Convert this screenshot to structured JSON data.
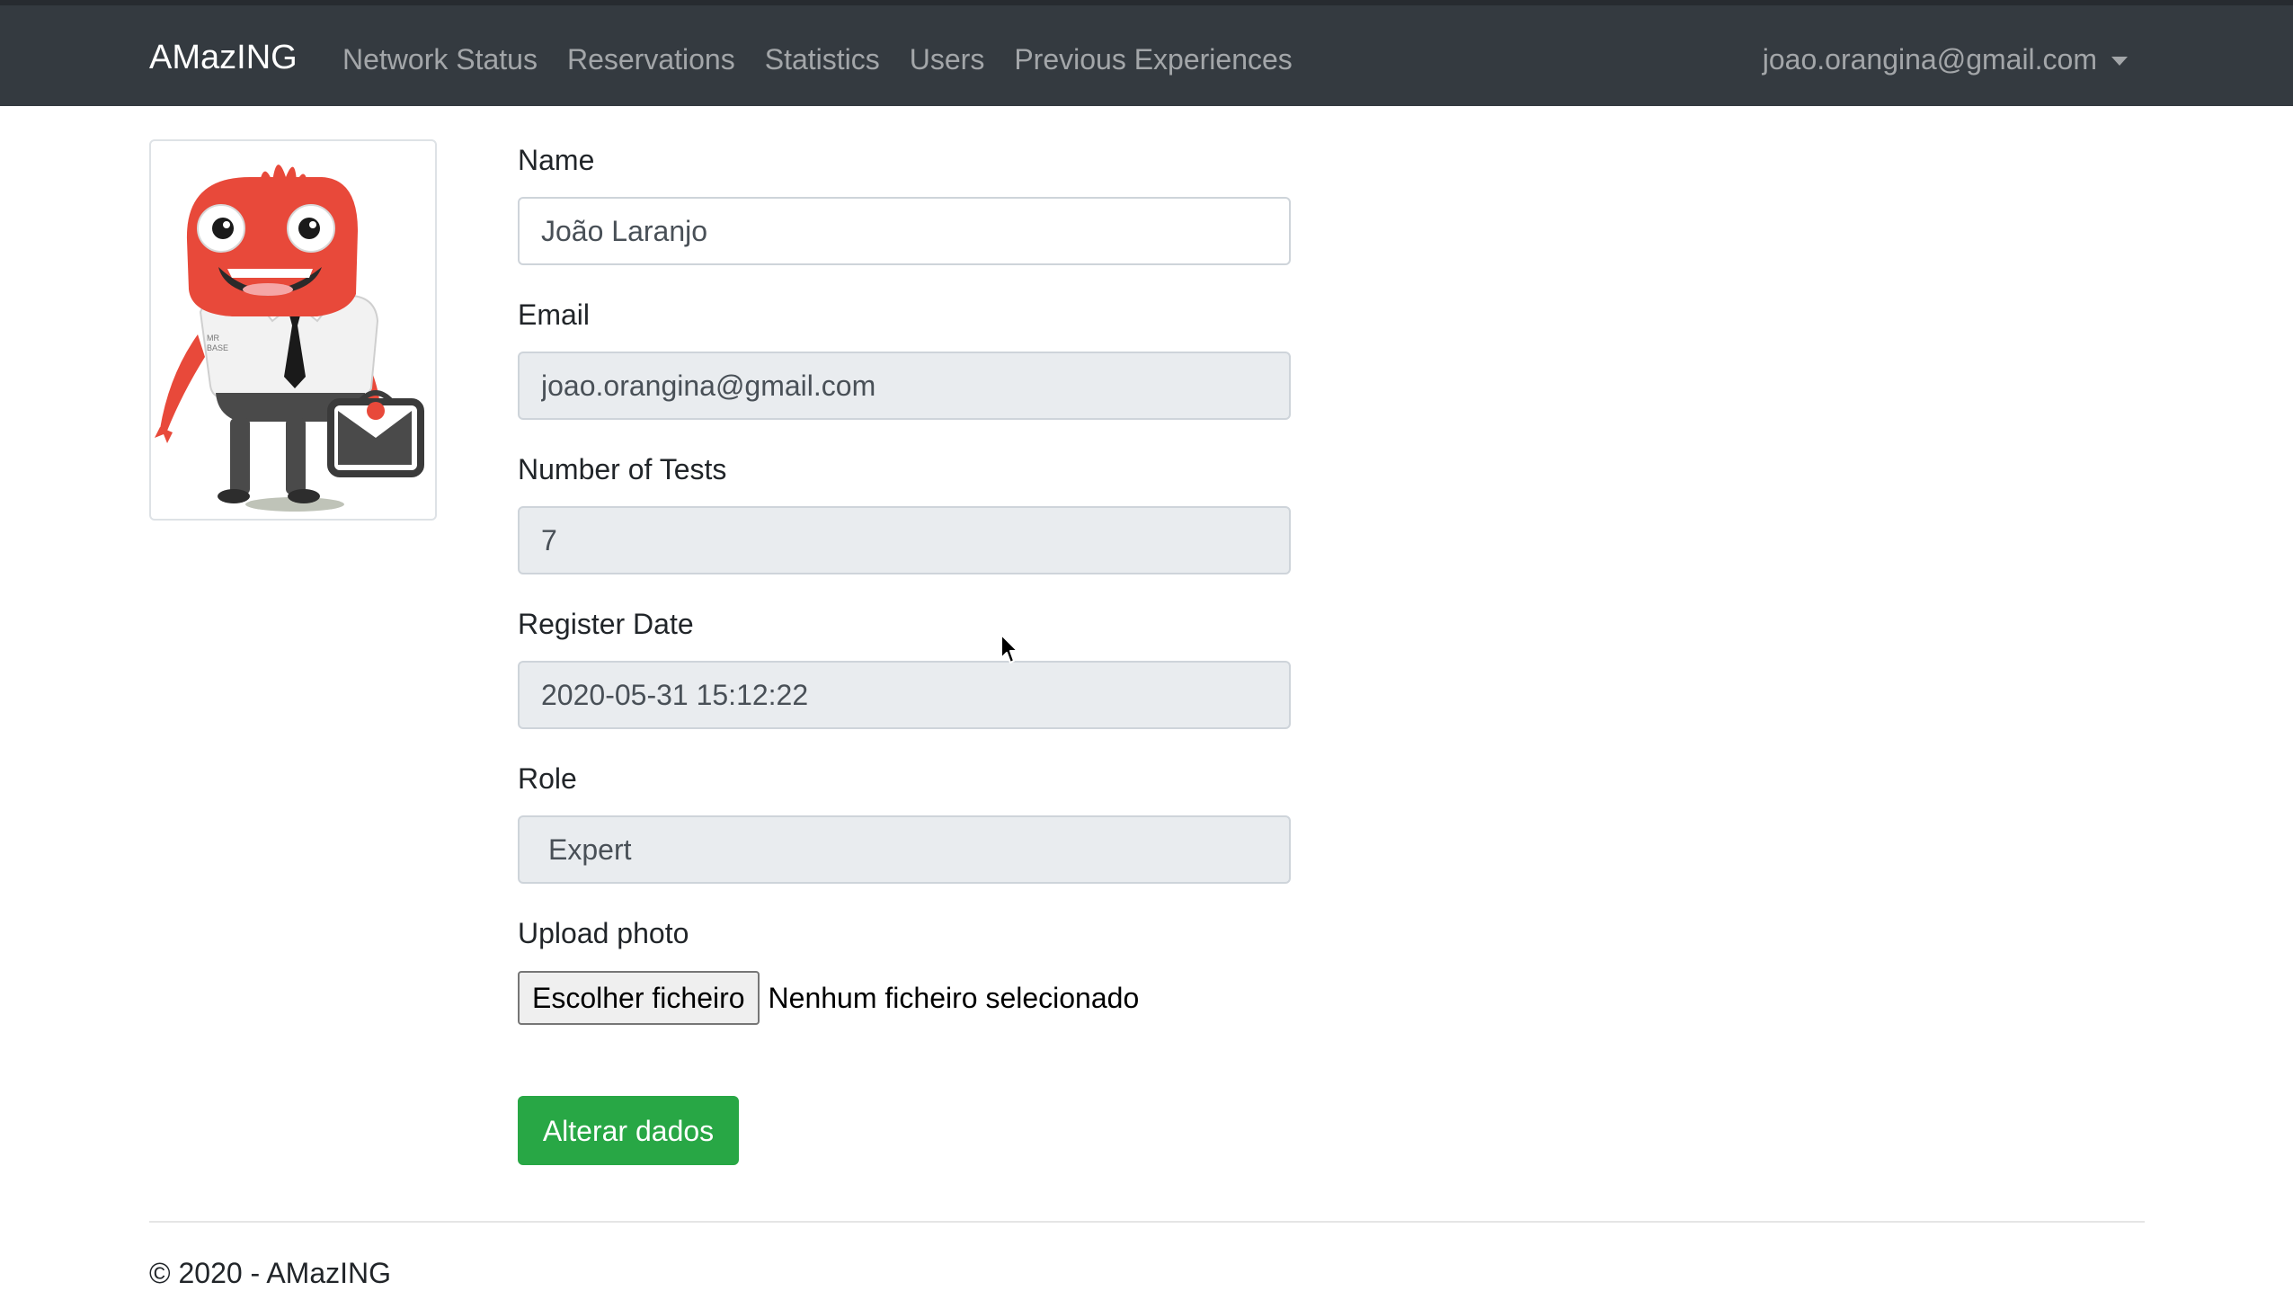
{
  "navbar": {
    "brand": "AMazING",
    "links": [
      "Network Status",
      "Reservations",
      "Statistics",
      "Users",
      "Previous Experiences"
    ],
    "user_email": "joao.orangina@gmail.com"
  },
  "avatar": {
    "icon": "monster-mascot-avatar",
    "badge_text": "MR BASE",
    "colors": {
      "skin": "#e8493a",
      "shirt": "#f2f2f2",
      "pants": "#4a4a4a",
      "tie": "#1a1a1a"
    }
  },
  "form": {
    "name": {
      "label": "Name",
      "value": "João Laranjo"
    },
    "email": {
      "label": "Email",
      "value": "joao.orangina@gmail.com"
    },
    "tests": {
      "label": "Number of Tests",
      "value": "7"
    },
    "register_date": {
      "label": "Register Date",
      "value": "2020-05-31 15:12:22"
    },
    "role": {
      "label": "Role",
      "value": "Expert"
    },
    "upload": {
      "label": "Upload photo",
      "button_label": "Escolher ficheiro",
      "status": "Nenhum ficheiro selecionado"
    },
    "submit_label": "Alterar dados"
  },
  "footer": {
    "text": "© 2020 - AMazING"
  },
  "colors": {
    "navbar_bg": "#343a40",
    "submit_bg": "#28a745",
    "readonly_bg": "#e9ecef"
  }
}
